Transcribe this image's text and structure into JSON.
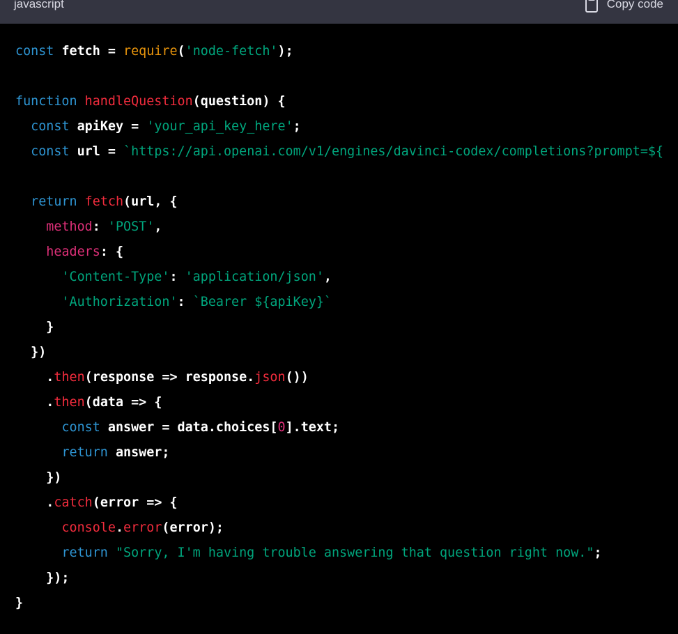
{
  "header": {
    "language": "javascript",
    "copy_label": "Copy code"
  },
  "colors": {
    "background": "#000000",
    "header": "#343541",
    "keyword": "#2e95d3",
    "function": "#f22c3d",
    "builtin": "#e9950c",
    "string": "#00a67d",
    "property": "#df3079"
  },
  "icons": {
    "copy": "clipboard-icon"
  },
  "code": {
    "lines": [
      [
        [
          "kw",
          "const"
        ],
        [
          "id",
          " fetch = "
        ],
        [
          "bi",
          "require"
        ],
        [
          "id",
          "("
        ],
        [
          "st",
          "'node-fetch'"
        ],
        [
          "id",
          ");"
        ]
      ],
      [],
      [
        [
          "kw",
          "function"
        ],
        [
          "id",
          " "
        ],
        [
          "fn",
          "handleQuestion"
        ],
        [
          "id",
          "(question) {"
        ]
      ],
      [
        [
          "id",
          "  "
        ],
        [
          "kw",
          "const"
        ],
        [
          "id",
          " apiKey = "
        ],
        [
          "st",
          "'your_api_key_here'"
        ],
        [
          "id",
          ";"
        ]
      ],
      [
        [
          "id",
          "  "
        ],
        [
          "kw",
          "const"
        ],
        [
          "id",
          " url = "
        ],
        [
          "st",
          "`https://api.openai.com/v1/engines/davinci-codex/completions?prompt=${"
        ]
      ],
      [],
      [
        [
          "id",
          "  "
        ],
        [
          "kw",
          "return"
        ],
        [
          "id",
          " "
        ],
        [
          "fn",
          "fetch"
        ],
        [
          "id",
          "(url, {"
        ]
      ],
      [
        [
          "id",
          "    "
        ],
        [
          "pr",
          "method"
        ],
        [
          "id",
          ": "
        ],
        [
          "st",
          "'POST'"
        ],
        [
          "id",
          ","
        ]
      ],
      [
        [
          "id",
          "    "
        ],
        [
          "pr",
          "headers"
        ],
        [
          "id",
          ": {"
        ]
      ],
      [
        [
          "id",
          "      "
        ],
        [
          "st",
          "'Content-Type'"
        ],
        [
          "id",
          ": "
        ],
        [
          "st",
          "'application/json'"
        ],
        [
          "id",
          ","
        ]
      ],
      [
        [
          "id",
          "      "
        ],
        [
          "st",
          "'Authorization'"
        ],
        [
          "id",
          ": "
        ],
        [
          "st",
          "`Bearer ${apiKey}`"
        ]
      ],
      [
        [
          "id",
          "    }"
        ]
      ],
      [
        [
          "id",
          "  })"
        ]
      ],
      [
        [
          "id",
          "    ."
        ],
        [
          "fn",
          "then"
        ],
        [
          "id",
          "(response => response."
        ],
        [
          "fn",
          "json"
        ],
        [
          "id",
          "())"
        ]
      ],
      [
        [
          "id",
          "    ."
        ],
        [
          "fn",
          "then"
        ],
        [
          "id",
          "(data => {"
        ]
      ],
      [
        [
          "id",
          "      "
        ],
        [
          "kw",
          "const"
        ],
        [
          "id",
          " answer = data.choices["
        ],
        [
          "nu",
          "0"
        ],
        [
          "id",
          "].text;"
        ]
      ],
      [
        [
          "id",
          "      "
        ],
        [
          "kw",
          "return"
        ],
        [
          "id",
          " answer;"
        ]
      ],
      [
        [
          "id",
          "    })"
        ]
      ],
      [
        [
          "id",
          "    ."
        ],
        [
          "fn",
          "catch"
        ],
        [
          "id",
          "(error => {"
        ]
      ],
      [
        [
          "id",
          "      "
        ],
        [
          "fn",
          "console"
        ],
        [
          "id",
          "."
        ],
        [
          "fn",
          "error"
        ],
        [
          "id",
          "(error);"
        ]
      ],
      [
        [
          "id",
          "      "
        ],
        [
          "kw",
          "return"
        ],
        [
          "id",
          " "
        ],
        [
          "st",
          "\"Sorry, I'm having trouble answering that question right now.\""
        ],
        [
          "id",
          ";"
        ]
      ],
      [
        [
          "id",
          "    });"
        ]
      ],
      [
        [
          "id",
          "}"
        ]
      ]
    ]
  }
}
